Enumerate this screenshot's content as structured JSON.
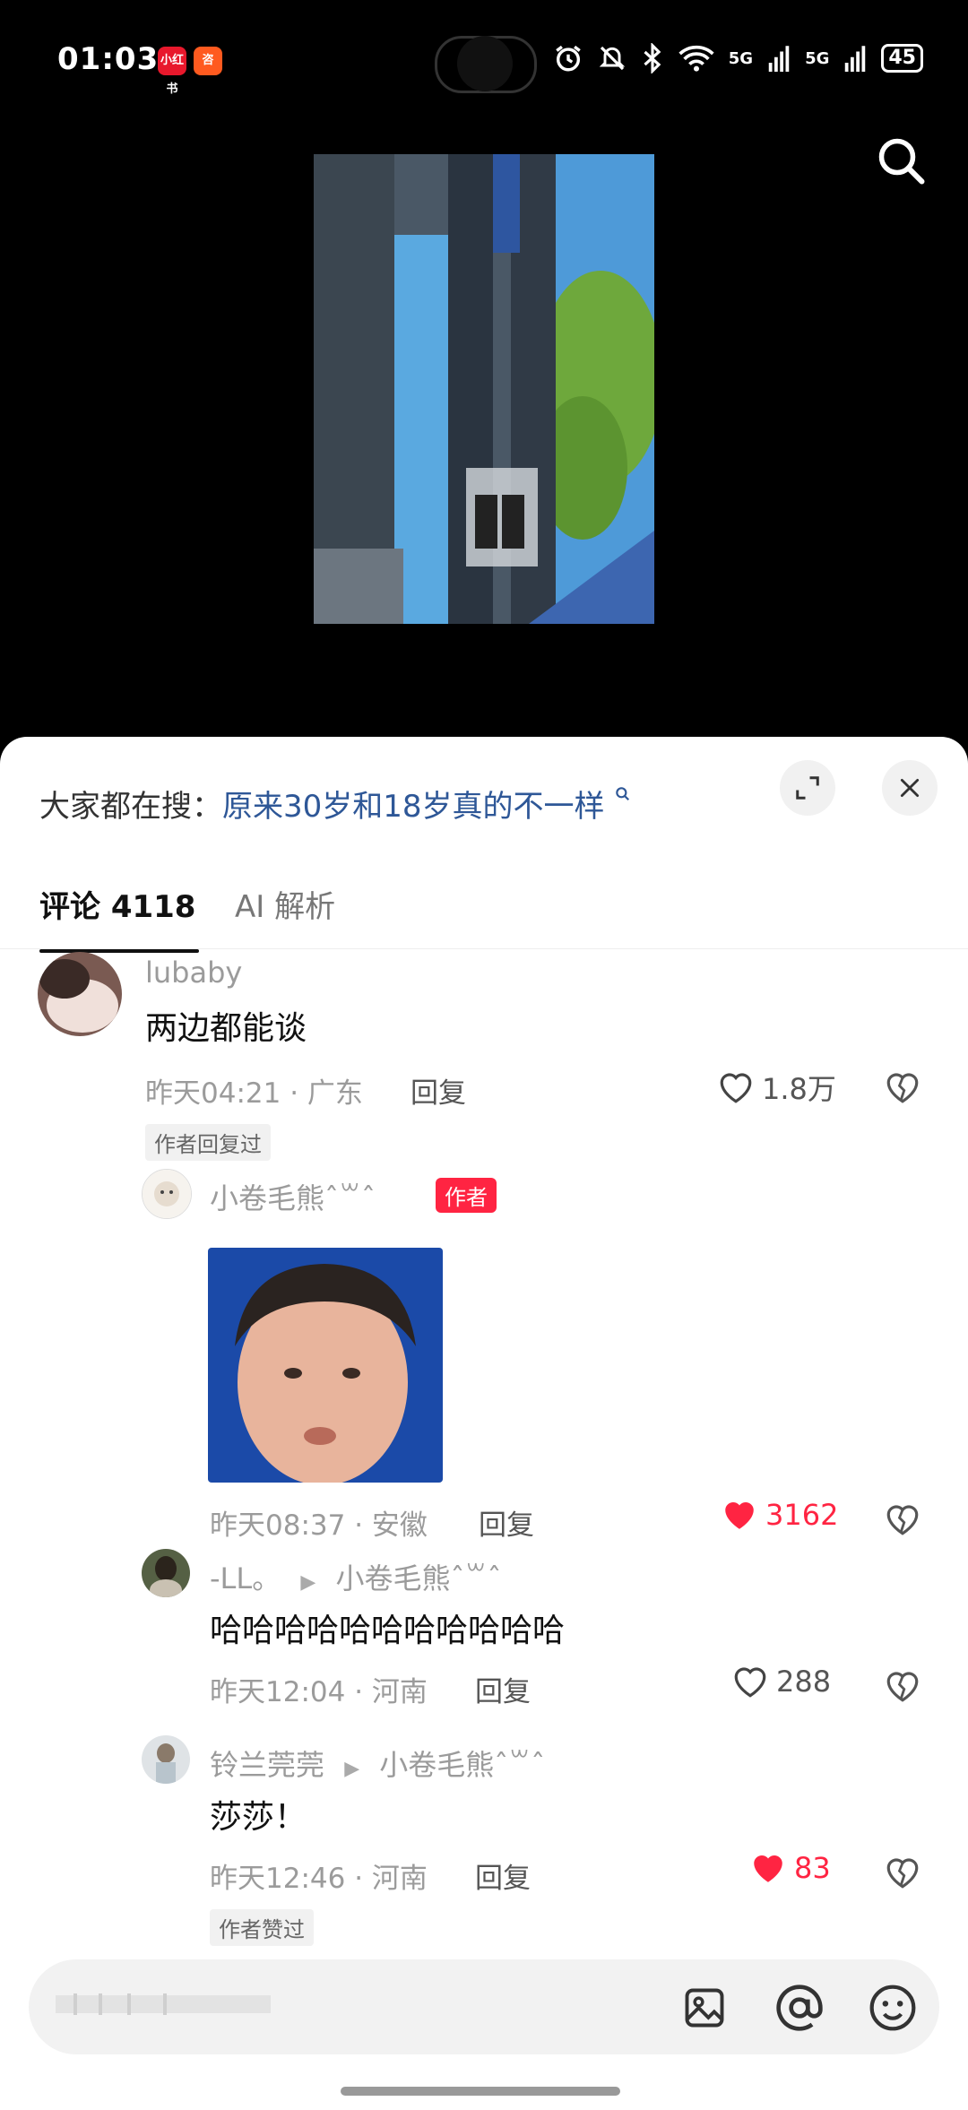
{
  "status_bar": {
    "time": "01:03",
    "app_badges": [
      "小红书",
      "咨"
    ],
    "network_1": "5G",
    "network_2": "5G",
    "battery": "45"
  },
  "sheet": {
    "hot_search_label": "大家都在搜：",
    "hot_search_query": "原来30岁和18岁真的不一样",
    "tabs": [
      {
        "label": "评论 4118",
        "active": true
      },
      {
        "label": "AI 解析",
        "active": false
      }
    ]
  },
  "comments": [
    {
      "user": "lubaby",
      "text": "两边都能谈",
      "time": "昨天04:21",
      "location": "广东",
      "reply_label": "回复",
      "likes": "1.8万",
      "tag": "作者回复过",
      "liked": false
    },
    {
      "user": "小卷毛熊ˆ꒳ˆ",
      "author_tag": "作者",
      "text": "",
      "time": "昨天08:37",
      "location": "安徽",
      "reply_label": "回复",
      "likes": "3162",
      "liked": true
    },
    {
      "user": "-LL。",
      "reply_to": "小卷毛熊ˆ꒳ˆ",
      "text": "哈哈哈哈哈哈哈哈哈哈哈",
      "time": "昨天12:04",
      "location": "河南",
      "reply_label": "回复",
      "likes": "288",
      "liked": false
    },
    {
      "user": "铃兰莞莞",
      "reply_to": "小卷毛熊ˆ꒳ˆ",
      "text": "莎莎！",
      "time": "昨天12:46",
      "location": "河南",
      "reply_label": "回复",
      "likes": "83",
      "liked": true,
      "tag": "作者赞过"
    }
  ],
  "input_bar": {
    "placeholder": "",
    "icons": [
      "image-icon",
      "at-icon",
      "emoji-icon"
    ]
  },
  "colors": {
    "accent_red": "#ff2442",
    "link_blue": "#2e5797"
  }
}
